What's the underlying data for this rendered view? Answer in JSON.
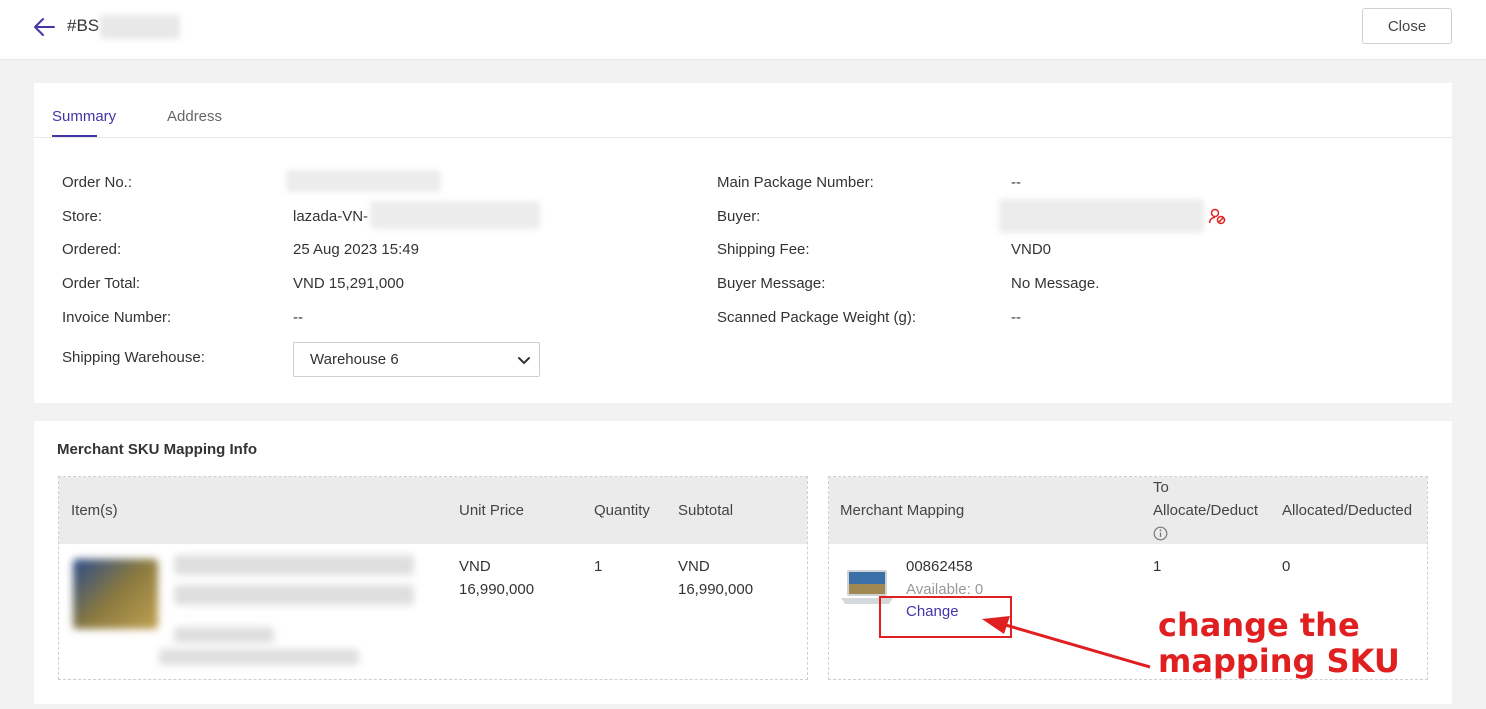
{
  "header": {
    "order_title": "#BS",
    "close_label": "Close"
  },
  "tabs": [
    {
      "label": "Summary",
      "active": true
    },
    {
      "label": "Address",
      "active": false
    }
  ],
  "summary": {
    "order_no_label": "Order No.:",
    "store_label": "Store:",
    "store_value": "lazada-VN-",
    "ordered_label": "Ordered:",
    "ordered_value": "25 Aug 2023 15:49",
    "order_total_label": "Order Total:",
    "order_total_value": "VND 15,291,000",
    "invoice_label": "Invoice Number:",
    "invoice_value": "--",
    "warehouse_label": "Shipping Warehouse:",
    "warehouse_value": "Warehouse 6",
    "main_package_label": "Main Package Number:",
    "main_package_value": "--",
    "buyer_label": "Buyer:",
    "shipping_fee_label": "Shipping Fee:",
    "shipping_fee_value": "VND0",
    "buyer_message_label": "Buyer Message:",
    "buyer_message_value": "No Message.",
    "scanned_weight_label": "Scanned Package Weight (g):",
    "scanned_weight_value": "--"
  },
  "mapping": {
    "section_title": "Merchant SKU Mapping Info",
    "left_headers": {
      "items": "Item(s)",
      "unit_price": "Unit Price",
      "quantity": "Quantity",
      "subtotal": "Subtotal"
    },
    "right_headers": {
      "merchant_mapping": "Merchant Mapping",
      "to_allocate_line1": "To",
      "to_allocate_line2": "Allocate/Deduct",
      "allocated": "Allocated/Deducted"
    },
    "row": {
      "unit_price_currency": "VND",
      "unit_price_amount": "16,990,000",
      "quantity": "1",
      "subtotal_currency": "VND",
      "subtotal_amount": "16,990,000",
      "sku": "00862458",
      "available": "Available: 0",
      "change_label": "Change",
      "to_allocate": "1",
      "allocated": "0"
    }
  },
  "annotation": {
    "line1": "change the",
    "line2": "mapping SKU",
    "color": "#e02020"
  },
  "colors": {
    "accent": "#3f37a8",
    "annotation": "#e02020"
  }
}
